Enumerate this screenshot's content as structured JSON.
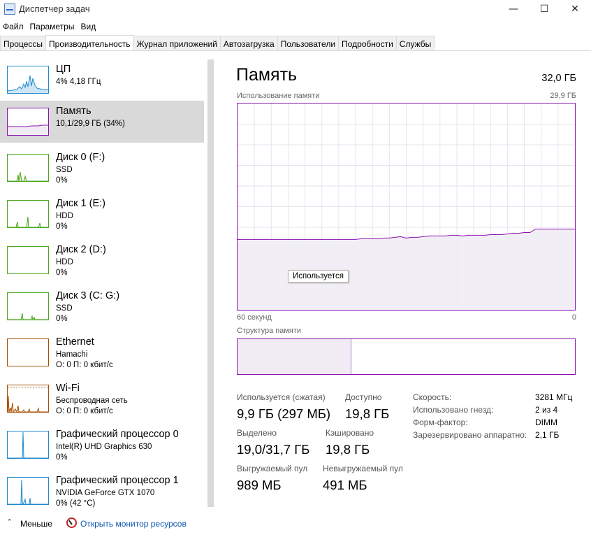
{
  "window": {
    "title": "Диспетчер задач",
    "icon": "task-manager-icon",
    "controls": {
      "minimize": "—",
      "maximize": "☐",
      "close": "✕"
    }
  },
  "menu": [
    "Файл",
    "Параметры",
    "Вид"
  ],
  "tabs": [
    {
      "label": "Процессы",
      "active": false
    },
    {
      "label": "Производительность",
      "active": true
    },
    {
      "label": "Журнал приложений",
      "active": false
    },
    {
      "label": "Автозагрузка",
      "active": false
    },
    {
      "label": "Пользователи",
      "active": false
    },
    {
      "label": "Подробности",
      "active": false
    },
    {
      "label": "Службы",
      "active": false
    }
  ],
  "sidebar": [
    {
      "title": "ЦП",
      "sub1": "4%  4,18 ГГц",
      "sub2": "",
      "color": "#1f8ad0"
    },
    {
      "title": "Память",
      "sub1": "10,1/29,9 ГБ (34%)",
      "sub2": "",
      "color": "#8b12ae"
    },
    {
      "title": "Диск 0 (F:)",
      "sub1": "SSD",
      "sub2": "0%",
      "color": "#4ca71d"
    },
    {
      "title": "Диск 1 (E:)",
      "sub1": "HDD",
      "sub2": "0%",
      "color": "#4ca71d"
    },
    {
      "title": "Диск 2 (D:)",
      "sub1": "HDD",
      "sub2": "0%",
      "color": "#4ca71d"
    },
    {
      "title": "Диск 3 (C: G:)",
      "sub1": "SSD",
      "sub2": "0%",
      "color": "#4ca71d"
    },
    {
      "title": "Ethernet",
      "sub1": "Hamachi",
      "sub2": "О: 0  П: 0 кбит/с",
      "color": "#a74f01"
    },
    {
      "title": "Wi-Fi",
      "sub1": "Беспроводная сеть",
      "sub2": "О: 0  П: 0 кбит/с",
      "color": "#a74f01"
    },
    {
      "title": "Графический процессор 0",
      "sub1": "Intel(R) UHD Graphics 630",
      "sub2": "0%",
      "color": "#1f8ad0"
    },
    {
      "title": "Графический процессор 1",
      "sub1": "NVIDIA GeForce GTX 1070",
      "sub2": "0% (42 °C)",
      "color": "#1f8ad0"
    }
  ],
  "detail": {
    "title": "Память",
    "total": "32,0 ГБ",
    "usage_label": "Использование памяти",
    "usage_max": "29,9 ГБ",
    "axis_left": "60 секунд",
    "axis_right": "0",
    "tooltip": "Используется",
    "structure_label": "Структура памяти",
    "structure_used_fraction": 0.337
  },
  "stats": {
    "in_use_label": "Используется (сжатая)",
    "in_use_value": "9,9 ГБ (297 МБ)",
    "available_label": "Доступно",
    "available_value": "19,8 ГБ",
    "committed_label": "Выделено",
    "committed_value": "19,0/31,7 ГБ",
    "cached_label": "Кэшировано",
    "cached_value": "19,8 ГБ",
    "paged_label": "Выгружаемый пул",
    "paged_value": "989 МБ",
    "nonpaged_label": "Невыгружаемый пул",
    "nonpaged_value": "491 МБ"
  },
  "specs": [
    {
      "label": "Скорость:",
      "value": "3281 МГц"
    },
    {
      "label": "Использовано гнезд:",
      "value": "2 из 4"
    },
    {
      "label": "Форм-фактор:",
      "value": "DIMM"
    },
    {
      "label": "Зарезервировано аппаратно:",
      "value": "2,1 ГБ"
    }
  ],
  "footer": {
    "fewer_label": "Меньше",
    "resmon_label": "Открыть монитор ресурсов"
  },
  "chart_data": {
    "type": "area",
    "title": "Использование памяти",
    "xlabel": "",
    "ylabel": "",
    "x_range_labels": [
      "60 секунд",
      "0"
    ],
    "ylim": [
      0,
      29.9
    ],
    "y_unit": "ГБ",
    "series": [
      {
        "name": "Используется",
        "color": "#8b12ae",
        "values": [
          10.2,
          10.2,
          10.2,
          10.2,
          10.2,
          10.2,
          10.2,
          10.2,
          10.2,
          10.2,
          10.2,
          10.2,
          10.2,
          10.2,
          10.2,
          10.2,
          10.2,
          10.2,
          10.2,
          10.2,
          10.2,
          10.2,
          10.3,
          10.3,
          10.3,
          10.3,
          10.4,
          10.4,
          10.5,
          10.6,
          10.4,
          10.5,
          10.5,
          10.6,
          10.7,
          10.7,
          10.7,
          10.7,
          10.8,
          10.8,
          10.7,
          10.8,
          10.8,
          10.8,
          10.8,
          10.9,
          10.9,
          10.9,
          11.0,
          11.1,
          11.1,
          11.2,
          11.2,
          11.7,
          11.7,
          11.7,
          11.7,
          11.7,
          11.7,
          11.7,
          11.7
        ]
      }
    ]
  }
}
